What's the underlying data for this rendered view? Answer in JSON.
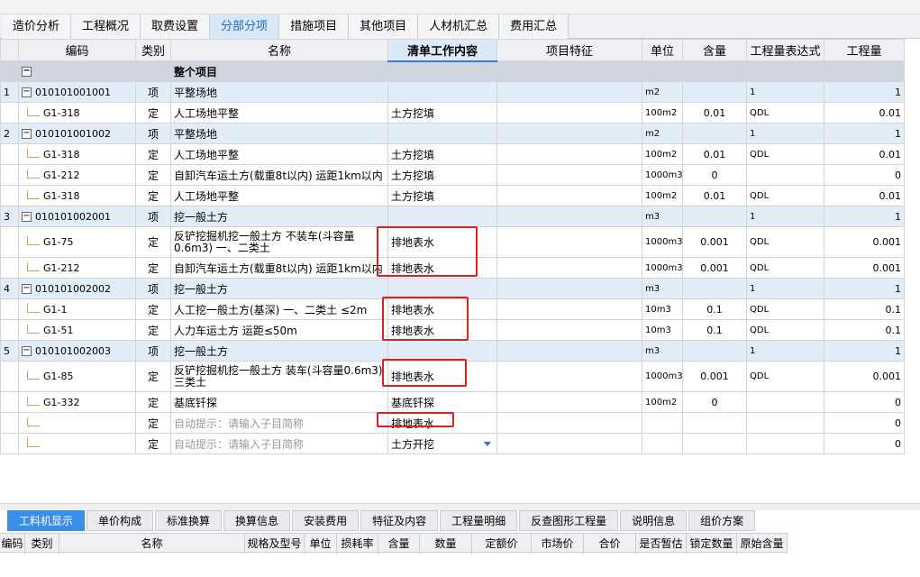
{
  "tabs": [
    "造价分析",
    "工程概况",
    "取费设置",
    "分部分项",
    "措施项目",
    "其他项目",
    "人材机汇总",
    "费用汇总"
  ],
  "active_tab": "分部分项",
  "columns": [
    "编码",
    "类别",
    "名称",
    "清单工作内容",
    "项目特征",
    "单位",
    "含量",
    "工程量表达式",
    "工程量"
  ],
  "section": {
    "box": "−",
    "name": "整个项目"
  },
  "rows": [
    {
      "kind": "item",
      "num": "1",
      "box": "−",
      "code": "010101001001",
      "type": "项",
      "name": "平整场地",
      "work": "",
      "unit": "m2",
      "qty": "",
      "expr": "1",
      "amount": "1"
    },
    {
      "kind": "sub",
      "code": "G1-318",
      "type": "定",
      "name": "人工场地平整",
      "work": "土方挖填",
      "unit": "100m2",
      "qty": "0.01",
      "expr": "QDL",
      "amount": "0.01"
    },
    {
      "kind": "item",
      "num": "2",
      "box": "−",
      "code": "010101001002",
      "type": "项",
      "name": "平整场地",
      "work": "",
      "unit": "m2",
      "qty": "",
      "expr": "1",
      "amount": "1"
    },
    {
      "kind": "sub",
      "code": "G1-318",
      "type": "定",
      "name": "人工场地平整",
      "work": "土方挖填",
      "unit": "100m2",
      "qty": "0.01",
      "expr": "QDL",
      "amount": "0.01"
    },
    {
      "kind": "sub",
      "code": "G1-212",
      "type": "定",
      "name": "自卸汽车运土方(载重8t以内) 运距1km以内",
      "work": "土方挖填",
      "unit": "1000m3",
      "qty": "0",
      "expr": "",
      "amount": "0"
    },
    {
      "kind": "sub",
      "code": "G1-318",
      "type": "定",
      "name": "人工场地平整",
      "work": "土方挖填",
      "unit": "100m2",
      "qty": "0.01",
      "expr": "QDL",
      "amount": "0.01"
    },
    {
      "kind": "item",
      "num": "3",
      "box": "−",
      "code": "010101002001",
      "type": "项",
      "name": "挖一般土方",
      "work": "",
      "unit": "m3",
      "qty": "",
      "expr": "1",
      "amount": "1"
    },
    {
      "kind": "sub",
      "tall": true,
      "code": "G1-75",
      "type": "定",
      "name": "反铲挖掘机挖一般土方 不装车(斗容量0.6m3) 一、二类土",
      "work": "排地表水",
      "unit": "1000m3",
      "qty": "0.001",
      "expr": "QDL",
      "amount": "0.001"
    },
    {
      "kind": "sub",
      "code": "G1-212",
      "type": "定",
      "name": "自卸汽车运土方(载重8t以内) 运距1km以内",
      "work": "排地表水",
      "unit": "1000m3",
      "qty": "0.001",
      "expr": "QDL",
      "amount": "0.001"
    },
    {
      "kind": "item",
      "num": "4",
      "box": "−",
      "code": "010101002002",
      "type": "项",
      "name": "挖一般土方",
      "work": "",
      "unit": "m3",
      "qty": "",
      "expr": "1",
      "amount": "1"
    },
    {
      "kind": "sub",
      "code": "G1-1",
      "type": "定",
      "name": "人工挖一般土方(基深) 一、二类土 ≤2m",
      "work": "排地表水",
      "unit": "10m3",
      "qty": "0.1",
      "expr": "QDL",
      "amount": "0.1"
    },
    {
      "kind": "sub",
      "code": "G1-51",
      "type": "定",
      "name": "人力车运土方 运距≤50m",
      "work": "排地表水",
      "unit": "10m3",
      "qty": "0.1",
      "expr": "QDL",
      "amount": "0.1"
    },
    {
      "kind": "item",
      "num": "5",
      "box": "−",
      "code": "010101002003",
      "type": "项",
      "name": "挖一般土方",
      "work": "",
      "unit": "m3",
      "qty": "",
      "expr": "1",
      "amount": "1"
    },
    {
      "kind": "sub",
      "tall": true,
      "code": "G1-85",
      "type": "定",
      "name": "反铲挖掘机挖一般土方 装车(斗容量0.6m3) 三类土",
      "work": "排地表水",
      "unit": "1000m3",
      "qty": "0.001",
      "expr": "QDL",
      "amount": "0.001"
    },
    {
      "kind": "sub",
      "code": "G1-332",
      "type": "定",
      "name": "基底钎探",
      "work": "基底钎探",
      "unit": "100m2",
      "qty": "0",
      "expr": "",
      "amount": "0"
    },
    {
      "kind": "sub",
      "hint": true,
      "code": "",
      "type": "定",
      "name": "自动提示：请输入子目简称",
      "work": "排地表水",
      "unit": "",
      "qty": "",
      "expr": "",
      "amount": "0"
    },
    {
      "kind": "sub",
      "hint": true,
      "dropdown": true,
      "code": "",
      "type": "定",
      "name": "自动提示：请输入子目简称",
      "work": "土方开挖",
      "unit": "",
      "qty": "",
      "expr": "",
      "amount": "0"
    }
  ],
  "bottom_tabs": [
    "工料机显示",
    "单价构成",
    "标准换算",
    "换算信息",
    "安装费用",
    "特征及内容",
    "工程量明细",
    "反查图形工程量",
    "说明信息",
    "组价方案"
  ],
  "active_bottom_tab": "工料机显示",
  "bottom_columns": [
    "编码",
    "类别",
    "名称",
    "规格及型号",
    "单位",
    "损耗率",
    "含量",
    "数量",
    "定额价",
    "市场价",
    "合价",
    "是否暂估",
    "锁定数量",
    "原始含量"
  ],
  "annotation_color": "#e02020"
}
